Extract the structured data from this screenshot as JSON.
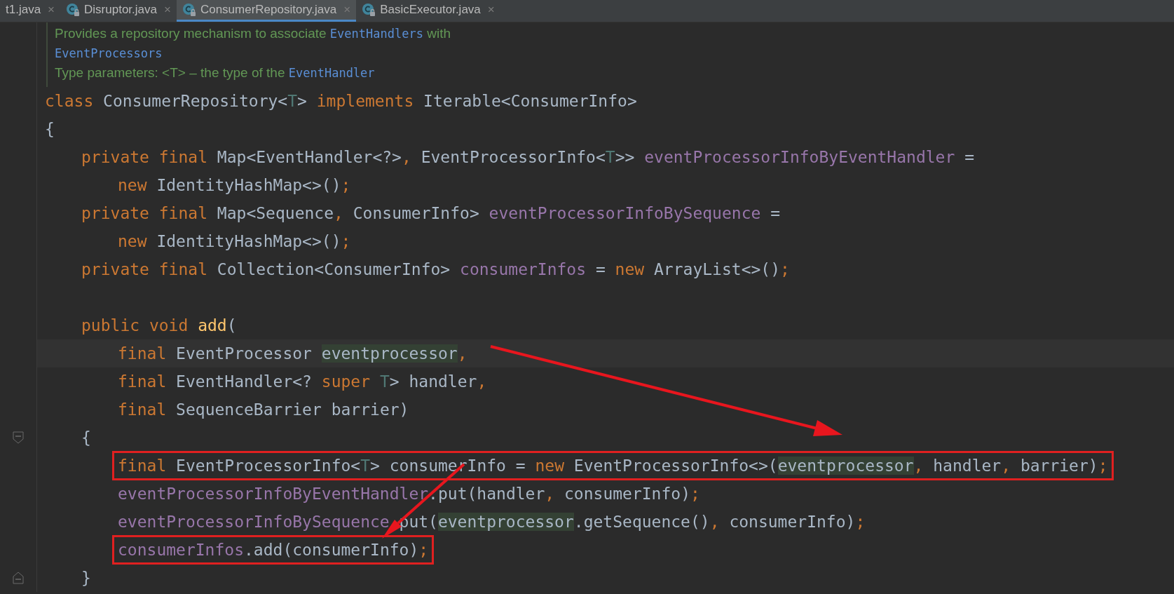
{
  "tabs": [
    {
      "label": "t1.java",
      "icon": false,
      "close": "×",
      "selected": false
    },
    {
      "label": "Disruptor.java",
      "icon": true,
      "close": "×",
      "selected": false
    },
    {
      "label": "ConsumerRepository.java",
      "icon": true,
      "close": "×",
      "selected": true
    },
    {
      "label": "BasicExecutor.java",
      "icon": true,
      "close": "×",
      "selected": false
    }
  ],
  "doc": [
    [
      {
        "kind": "text",
        "text": "Provides a repository mechanism to associate "
      },
      {
        "kind": "link",
        "text": "EventHandlers"
      },
      {
        "kind": "text",
        "text": " with"
      }
    ],
    [
      {
        "kind": "link",
        "text": "EventProcessors"
      }
    ],
    [
      {
        "kind": "text",
        "text": "Type parameters: <T> – the type of the "
      },
      {
        "kind": "link",
        "text": "EventHandler"
      }
    ]
  ],
  "lines": [
    {
      "kind": "top",
      "tokens": [
        {
          "kind": "kw",
          "text": "class"
        },
        {
          "kind": "plain",
          "text": " ConsumerRepository<"
        },
        {
          "kind": "tparam",
          "text": "T"
        },
        {
          "kind": "plain",
          "text": "> "
        },
        {
          "kind": "kw",
          "text": "implements"
        },
        {
          "kind": "plain",
          "text": " Iterable<ConsumerInfo>"
        }
      ]
    },
    {
      "kind": "top",
      "tokens": [
        {
          "kind": "plain",
          "text": "{"
        }
      ]
    },
    {
      "kind": "member",
      "tokens": [
        {
          "kind": "kw",
          "text": "private final"
        },
        {
          "kind": "plain",
          "text": " Map<EventHandler<?>"
        },
        {
          "kind": "punct",
          "text": ","
        },
        {
          "kind": "plain",
          "text": " EventProcessorInfo<"
        },
        {
          "kind": "tparam",
          "text": "T"
        },
        {
          "kind": "plain",
          "text": ">> "
        },
        {
          "kind": "field",
          "text": "eventProcessorInfoByEventHandler"
        },
        {
          "kind": "plain",
          "text": " ="
        }
      ]
    },
    {
      "kind": "body",
      "tokens": [
        {
          "kind": "kw",
          "text": "new"
        },
        {
          "kind": "plain",
          "text": " IdentityHashMap<>()"
        },
        {
          "kind": "punct",
          "text": ";"
        }
      ]
    },
    {
      "kind": "member",
      "tokens": [
        {
          "kind": "kw",
          "text": "private final"
        },
        {
          "kind": "plain",
          "text": " Map<Sequence"
        },
        {
          "kind": "punct",
          "text": ","
        },
        {
          "kind": "plain",
          "text": " ConsumerInfo> "
        },
        {
          "kind": "field",
          "text": "eventProcessorInfoBySequence"
        },
        {
          "kind": "plain",
          "text": " ="
        }
      ]
    },
    {
      "kind": "body",
      "tokens": [
        {
          "kind": "kw",
          "text": "new"
        },
        {
          "kind": "plain",
          "text": " IdentityHashMap<>()"
        },
        {
          "kind": "punct",
          "text": ";"
        }
      ]
    },
    {
      "kind": "member",
      "tokens": [
        {
          "kind": "kw",
          "text": "private final"
        },
        {
          "kind": "plain",
          "text": " Collection<ConsumerInfo> "
        },
        {
          "kind": "field",
          "text": "consumerInfos"
        },
        {
          "kind": "plain",
          "text": " = "
        },
        {
          "kind": "kw",
          "text": "new"
        },
        {
          "kind": "plain",
          "text": " ArrayList<>()"
        },
        {
          "kind": "punct",
          "text": ";"
        }
      ]
    },
    {
      "kind": "blank"
    },
    {
      "kind": "member",
      "tokens": [
        {
          "kind": "kw",
          "text": "public void "
        },
        {
          "kind": "fn",
          "text": "add"
        },
        {
          "kind": "plain",
          "text": "("
        }
      ]
    },
    {
      "kind": "body",
      "current": true,
      "tokens": [
        {
          "kind": "kw",
          "text": "final"
        },
        {
          "kind": "plain",
          "text": " EventProcessor "
        },
        {
          "kind": "usage",
          "text": "eventprocessor"
        },
        {
          "kind": "punct",
          "text": ","
        }
      ]
    },
    {
      "kind": "body",
      "tokens": [
        {
          "kind": "kw",
          "text": "final"
        },
        {
          "kind": "plain",
          "text": " EventHandler<? "
        },
        {
          "kind": "kw",
          "text": "super "
        },
        {
          "kind": "tparam",
          "text": "T"
        },
        {
          "kind": "plain",
          "text": "> handler"
        },
        {
          "kind": "punct",
          "text": ","
        }
      ]
    },
    {
      "kind": "body",
      "tokens": [
        {
          "kind": "kw",
          "text": "final"
        },
        {
          "kind": "plain",
          "text": " SequenceBarrier barrier)"
        }
      ]
    },
    {
      "kind": "member",
      "fold_open": true,
      "tokens": [
        {
          "kind": "plain",
          "text": "{"
        }
      ]
    },
    {
      "kind": "body",
      "boxed": true,
      "tokens": [
        {
          "kind": "kw",
          "text": "final"
        },
        {
          "kind": "plain",
          "text": " EventProcessorInfo<"
        },
        {
          "kind": "tparam",
          "text": "T"
        },
        {
          "kind": "plain",
          "text": "> consumerInfo = "
        },
        {
          "kind": "kw",
          "text": "new"
        },
        {
          "kind": "plain",
          "text": " EventProcessorInfo<>("
        },
        {
          "kind": "usage",
          "text": "eventprocessor"
        },
        {
          "kind": "punct",
          "text": ","
        },
        {
          "kind": "plain",
          "text": " handler"
        },
        {
          "kind": "punct",
          "text": ","
        },
        {
          "kind": "plain",
          "text": " barrier)"
        },
        {
          "kind": "punct",
          "text": ";"
        }
      ]
    },
    {
      "kind": "body",
      "tokens": [
        {
          "kind": "field",
          "text": "eventProcessorInfoByEventHandler"
        },
        {
          "kind": "plain",
          "text": ".put(handler"
        },
        {
          "kind": "punct",
          "text": ","
        },
        {
          "kind": "plain",
          "text": " consumerInfo)"
        },
        {
          "kind": "punct",
          "text": ";"
        }
      ]
    },
    {
      "kind": "body",
      "tokens": [
        {
          "kind": "field",
          "text": "eventProcessorInfoBySequence"
        },
        {
          "kind": "hidden"
        },
        {
          "kind": "plain",
          "text": "put("
        },
        {
          "kind": "usage",
          "text": "eventprocessor"
        },
        {
          "kind": "plain",
          "text": ".getSequence()"
        },
        {
          "kind": "punct",
          "text": ","
        },
        {
          "kind": "plain",
          "text": " consumerInfo)"
        },
        {
          "kind": "punct",
          "text": ";"
        }
      ]
    },
    {
      "kind": "body",
      "boxed": true,
      "tokens": [
        {
          "kind": "field",
          "text": "consumerInfos"
        },
        {
          "kind": "plain",
          "text": ".add(consumerInfo)"
        },
        {
          "kind": "punct",
          "text": ";"
        }
      ]
    },
    {
      "kind": "member",
      "fold_close": true,
      "tokens": [
        {
          "kind": "plain",
          "text": "}"
        }
      ]
    }
  ]
}
